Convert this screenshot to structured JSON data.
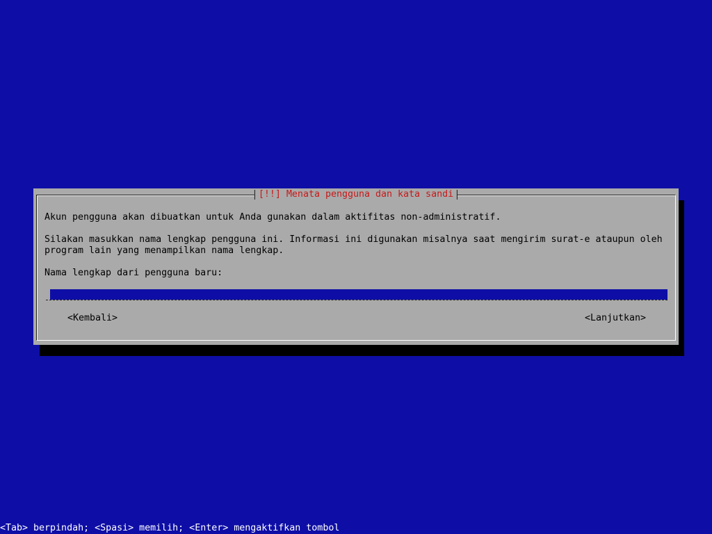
{
  "dialog": {
    "title": "[!!] Menata pengguna dan kata sandi",
    "paragraph1": "Akun pengguna akan dibuatkan untuk Anda gunakan dalam aktifitas non-administratif.",
    "paragraph2_line1": "Silakan masukkan nama lengkap pengguna ini. Informasi ini digunakan misalnya saat mengirim surat-e ataupun oleh",
    "paragraph2_line2": "program lain yang menampilkan nama lengkap.",
    "field_label": "Nama lengkap dari pengguna baru:",
    "field_value": "",
    "back_button": "<Kembali>",
    "continue_button": "<Lanjutkan>"
  },
  "status_bar": {
    "text": "<Tab> berpindah; <Spasi> memilih; <Enter> mengaktifkan tombol"
  },
  "colors": {
    "background": "#0e0ea6",
    "dialog": "#aaaaaa",
    "title": "#c8191a",
    "entry": "#0e0ea6",
    "status_text": "#ffffff"
  }
}
